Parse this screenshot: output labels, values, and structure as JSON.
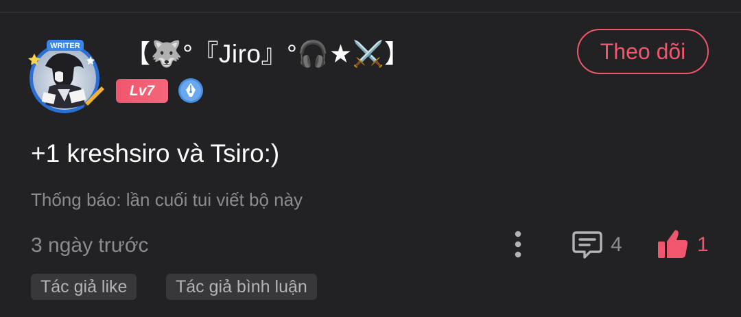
{
  "post": {
    "username": "【🐺°『Jiro』°🎧★⚔️】",
    "level": "Lv7",
    "follow_label": "Theo dõi",
    "title": "+1 kreshsiro và Tsiro:)",
    "subtitle": "Thống báo: lần cuối tui viết bộ này",
    "time_ago": "3 ngày trước",
    "comment_count": "4",
    "like_count": "1",
    "avatar_frame_label": "WRITER"
  },
  "tags": [
    {
      "label": "Tác giả like"
    },
    {
      "label": "Tác giả bình luận"
    }
  ],
  "colors": {
    "background": "#222224",
    "accent": "#f0566e",
    "muted_text": "#8c8c90",
    "tag_bg": "#38383b",
    "badge_blue": "#4a90e2"
  },
  "icons": {
    "avatar": "writer-avatar",
    "badge": "pen-badge-icon",
    "more": "more-vertical-icon",
    "comment": "comment-icon",
    "like": "thumbs-up-icon"
  }
}
